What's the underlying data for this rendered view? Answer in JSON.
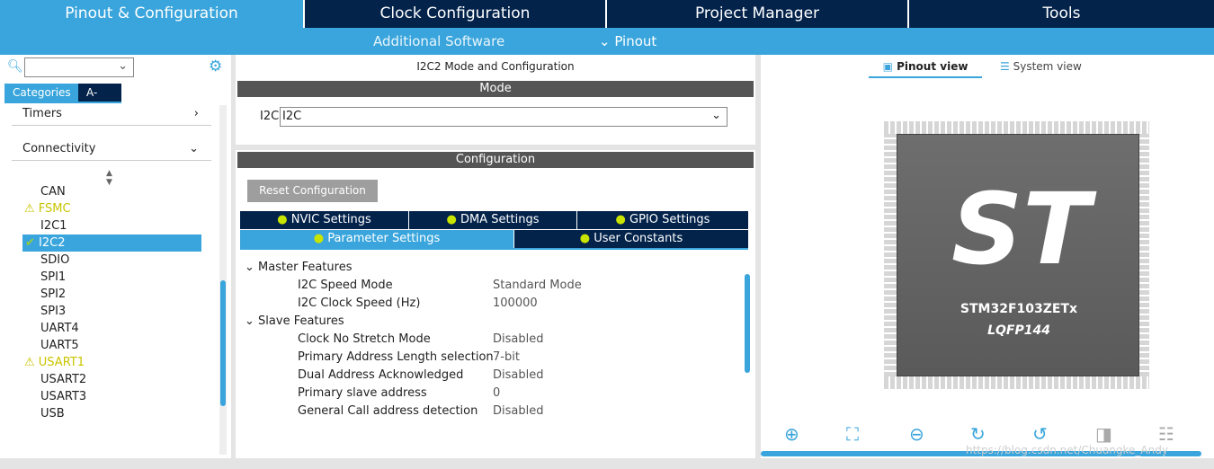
{
  "top_tabs": [
    "Pinout & Configuration",
    "Clock Configuration",
    "Project Manager",
    "Tools"
  ],
  "sub_menu": {
    "additional_software": "Additional Software",
    "pinout": "Pinout"
  },
  "left": {
    "categories_tab": "Categories",
    "az_tab": "A->Z",
    "timers": "Timers",
    "connectivity": "Connectivity",
    "items": [
      "CAN",
      "FSMC",
      "I2C1",
      "I2C2",
      "SDIO",
      "SPI1",
      "SPI2",
      "SPI3",
      "UART4",
      "UART5",
      "USART1",
      "USART2",
      "USART3",
      "USB"
    ]
  },
  "mid": {
    "title": "I2C2 Mode and Configuration",
    "mode_header": "Mode",
    "i2c_label": "I2C",
    "i2c_value": "I2C",
    "config_header": "Configuration",
    "reset_btn": "Reset Configuration",
    "tabs": [
      "NVIC Settings",
      "DMA Settings",
      "GPIO Settings",
      "Parameter Settings",
      "User Constants"
    ],
    "master_group": "Master Features",
    "slave_group": "Slave Features",
    "params": [
      {
        "name": "I2C Speed Mode",
        "value": "Standard Mode"
      },
      {
        "name": "I2C Clock Speed (Hz)",
        "value": "100000"
      },
      {
        "name": "Clock No Stretch Mode",
        "value": "Disabled"
      },
      {
        "name": "Primary Address Length selection",
        "value": "7-bit"
      },
      {
        "name": "Dual Address Acknowledged",
        "value": "Disabled"
      },
      {
        "name": "Primary slave address",
        "value": "0"
      },
      {
        "name": "General Call address detection",
        "value": "Disabled"
      }
    ]
  },
  "right": {
    "pinout_view": "Pinout view",
    "system_view": "System view",
    "chip_name": "STM32F103ZETx",
    "package": "LQFP144",
    "watermark": "https://blog.csdn.net/Chuangke_Andy"
  }
}
